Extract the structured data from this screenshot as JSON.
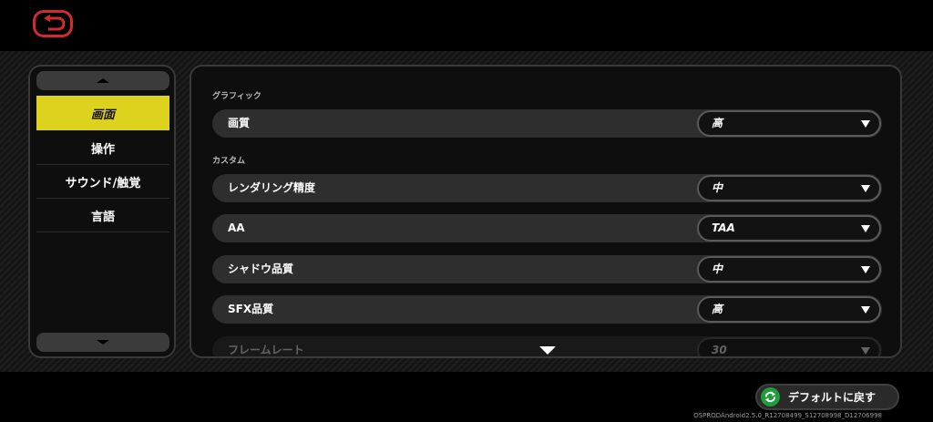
{
  "nav": {
    "back_icon": "undo-arrow-icon",
    "back_color": "#d32a32"
  },
  "sidebar": {
    "items": [
      {
        "label": "画面",
        "active": true
      },
      {
        "label": "操作",
        "active": false
      },
      {
        "label": "サウンド/触覚",
        "active": false
      },
      {
        "label": "言語",
        "active": false
      }
    ],
    "active_color": "#ddd31f"
  },
  "content": {
    "sections": [
      {
        "label": "グラフィック",
        "rows": [
          {
            "label": "画質",
            "value": "高"
          }
        ]
      },
      {
        "label": "カスタム",
        "rows": [
          {
            "label": "レンダリング精度",
            "value": "中"
          },
          {
            "label": "AA",
            "value": "TAA"
          },
          {
            "label": "シャドウ品質",
            "value": "中"
          },
          {
            "label": "SFX品質",
            "value": "高"
          },
          {
            "label": "フレームレート",
            "value": "30"
          }
        ]
      }
    ]
  },
  "footer": {
    "default_button_label": "デフォルトに戻す",
    "default_icon": "reset-cycle-icon",
    "default_icon_color": "#1f9d3a",
    "version": "OSPRODAndroid2.5.0_R12708499_S12708998_D12706998"
  }
}
